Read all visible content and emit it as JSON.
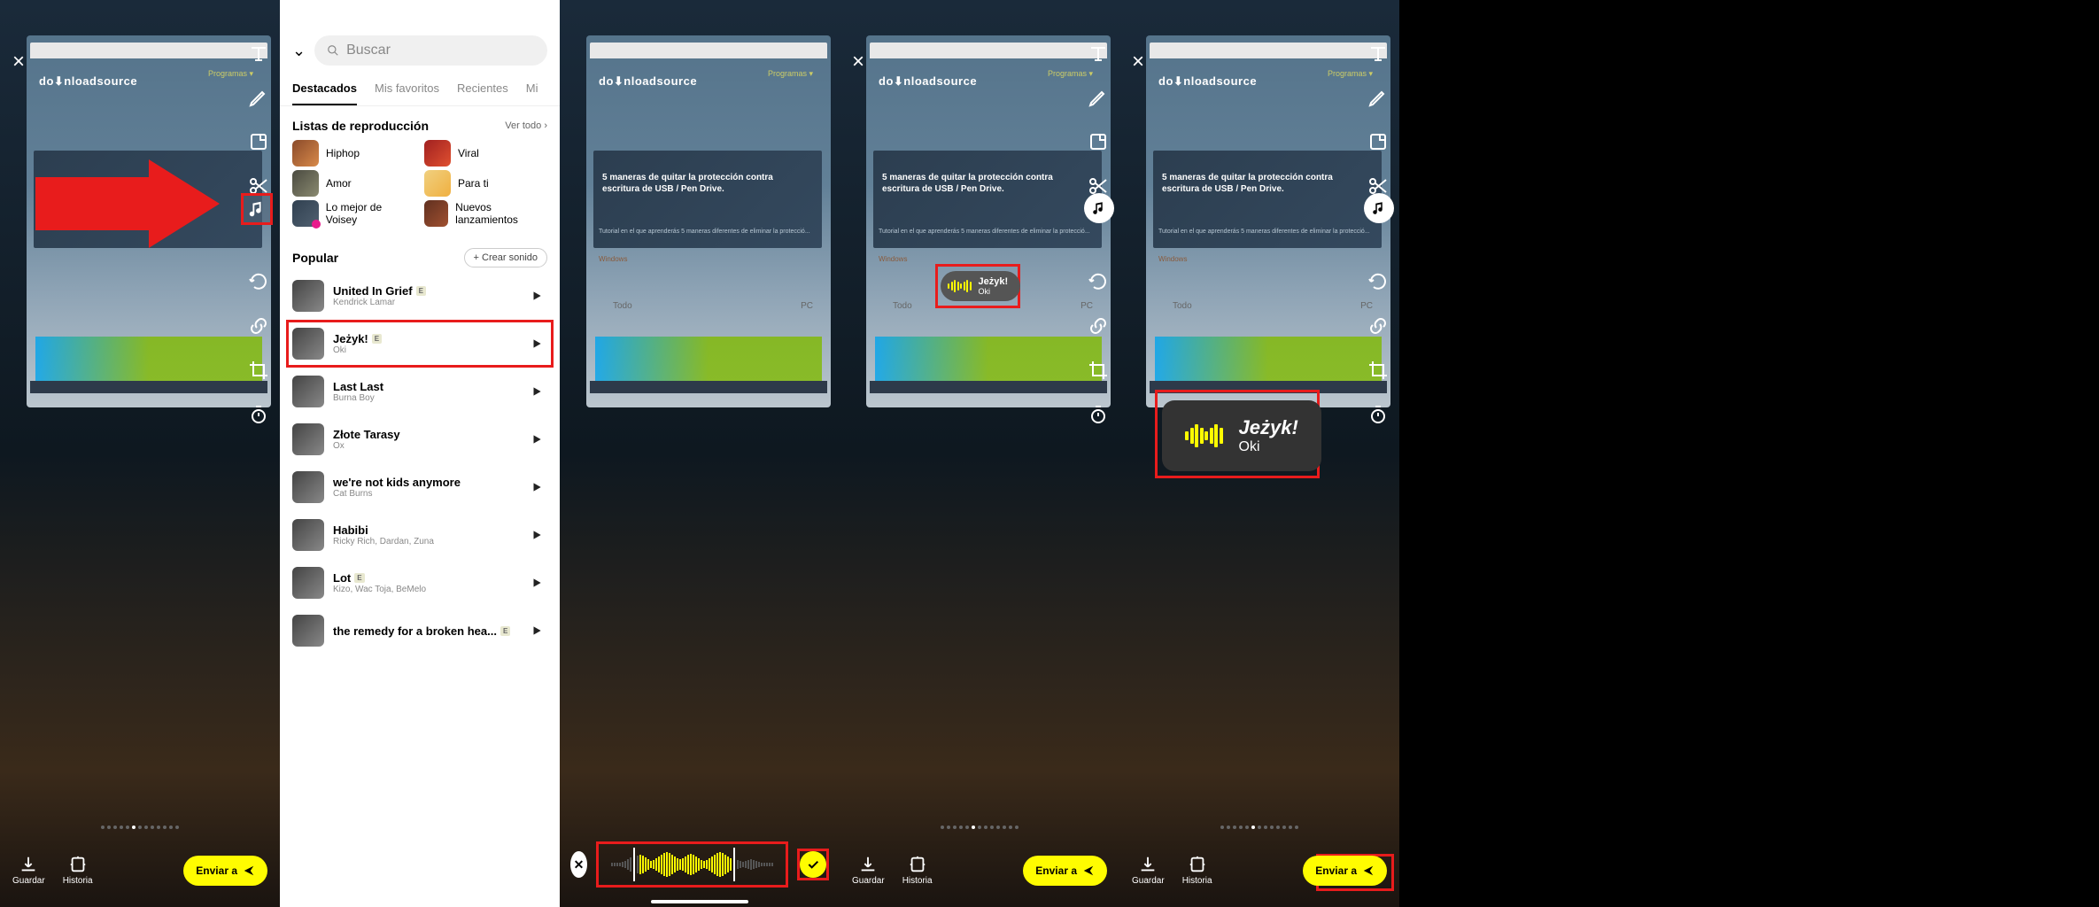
{
  "common": {
    "close": "×",
    "save_label": "Guardar",
    "story_label": "Historia",
    "send_label": "Enviar a",
    "brand": "do⬇nloadsource",
    "programas": "Programas ▾",
    "article_title": "5 maneras de quitar la protección contra escritura de USB / Pen Drive.",
    "article_sub": "Tutorial en el que aprenderás 5 maneras diferentes de eliminar la protecció...",
    "tag_windows": "Windows",
    "pc_todo": "Todo",
    "pc_pc": "PC"
  },
  "search": {
    "placeholder": "Buscar"
  },
  "tabs": [
    "Destacados",
    "Mis favoritos",
    "Recientes",
    "Mi"
  ],
  "playlists": {
    "title": "Listas de reproducción",
    "see_all": "Ver todo",
    "items": [
      "Hiphop",
      "Viral",
      "Amor",
      "Para ti",
      "Lo mejor de Voisey",
      "Nuevos lanzamientos"
    ]
  },
  "popular": {
    "title": "Popular",
    "create": "Crear sonido",
    "songs": [
      {
        "title": "United In Grief",
        "artist": "Kendrick Lamar",
        "explicit": true
      },
      {
        "title": "Jeżyk!",
        "artist": "Oki",
        "explicit": true
      },
      {
        "title": "Last Last",
        "artist": "Burna Boy",
        "explicit": false
      },
      {
        "title": "Złote Tarasy",
        "artist": "Ox",
        "explicit": false
      },
      {
        "title": "we're not kids anymore",
        "artist": "Cat Burns",
        "explicit": false
      },
      {
        "title": "Habibi",
        "artist": "Ricky Rich, Dardan, Zuna",
        "explicit": false
      },
      {
        "title": "Lot",
        "artist": "Kizo, Wac Toja, BeMelo",
        "explicit": true
      },
      {
        "title": "the remedy for a broken hea...",
        "artist": "",
        "explicit": true
      }
    ]
  },
  "chip": {
    "title": "Jeżyk!",
    "artist": "Oki"
  },
  "colors": {
    "accent": "#fffc00",
    "highlight": "#e81c1c"
  }
}
